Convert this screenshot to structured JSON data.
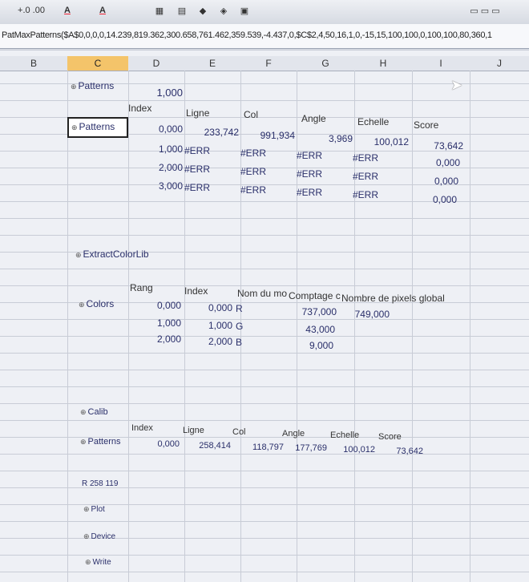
{
  "toolbar": {
    "items": [
      "+.0 .00",
      "A",
      "A"
    ]
  },
  "formula_bar": {
    "text": "PatMaxPatterns($A$0,0,0,0,14.239,819.362,300.658,761.462,359.539,-4.437,0,$C$2,4,50,16,1,0,-15,15,100,100,0,100,100,80,360,1"
  },
  "columns": [
    "B",
    "C",
    "D",
    "E",
    "F",
    "G",
    "H",
    "I",
    "J"
  ],
  "patterns1": {
    "title": "Patterns",
    "count": "1,000",
    "headers": [
      "Index",
      "Ligne",
      "Col",
      "Angle",
      "Echelle",
      "Score"
    ],
    "name": "Patterns",
    "rows": [
      [
        "0,000",
        "233,742",
        "991,934",
        "3,969",
        "100,012",
        "73,642"
      ],
      [
        "1,000",
        "#ERR",
        "#ERR",
        "#ERR",
        "#ERR",
        "0,000"
      ],
      [
        "2,000",
        "#ERR",
        "#ERR",
        "#ERR",
        "#ERR",
        "0,000"
      ],
      [
        "3,000",
        "#ERR",
        "#ERR",
        "#ERR",
        "#ERR",
        "0,000"
      ]
    ]
  },
  "extract": {
    "title": "ExtractColorLib"
  },
  "colors": {
    "label": "Colors",
    "headers": [
      "Rang",
      "Index",
      "Nom du mo",
      "Comptage c",
      "Nombre de pixels global"
    ],
    "rows": [
      [
        "0,000",
        "0,000",
        "R",
        "737,000",
        "749,000"
      ],
      [
        "1,000",
        "1,000",
        "G",
        "43,000",
        ""
      ],
      [
        "2,000",
        "2,000",
        "B",
        "9,000",
        ""
      ]
    ]
  },
  "calib": {
    "title": "Calib",
    "headers": [
      "Index",
      "Ligne",
      "Col",
      "Angle",
      "Echelle",
      "Score"
    ],
    "label": "Patterns",
    "row": [
      "0,000",
      "258,414",
      "118,797",
      "177,769",
      "100,012",
      "73,642"
    ]
  },
  "misc": {
    "r_text": "R 258 119",
    "plot": "Plot",
    "device": "Device",
    "write": "Write"
  }
}
